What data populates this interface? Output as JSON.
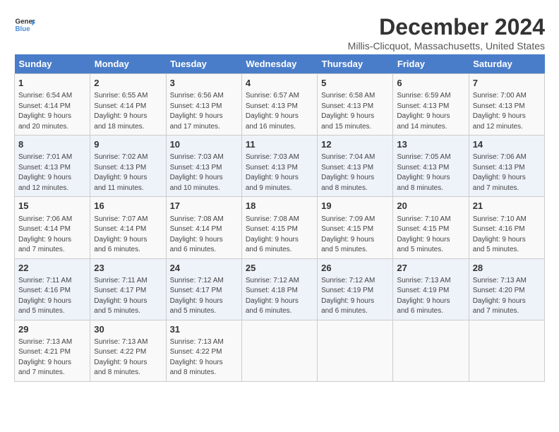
{
  "logo": {
    "general": "General",
    "blue": "Blue"
  },
  "title": "December 2024",
  "location": "Millis-Clicquot, Massachusetts, United States",
  "days_of_week": [
    "Sunday",
    "Monday",
    "Tuesday",
    "Wednesday",
    "Thursday",
    "Friday",
    "Saturday"
  ],
  "weeks": [
    [
      {
        "day": "1",
        "info": "Sunrise: 6:54 AM\nSunset: 4:14 PM\nDaylight: 9 hours\nand 20 minutes."
      },
      {
        "day": "2",
        "info": "Sunrise: 6:55 AM\nSunset: 4:14 PM\nDaylight: 9 hours\nand 18 minutes."
      },
      {
        "day": "3",
        "info": "Sunrise: 6:56 AM\nSunset: 4:13 PM\nDaylight: 9 hours\nand 17 minutes."
      },
      {
        "day": "4",
        "info": "Sunrise: 6:57 AM\nSunset: 4:13 PM\nDaylight: 9 hours\nand 16 minutes."
      },
      {
        "day": "5",
        "info": "Sunrise: 6:58 AM\nSunset: 4:13 PM\nDaylight: 9 hours\nand 15 minutes."
      },
      {
        "day": "6",
        "info": "Sunrise: 6:59 AM\nSunset: 4:13 PM\nDaylight: 9 hours\nand 14 minutes."
      },
      {
        "day": "7",
        "info": "Sunrise: 7:00 AM\nSunset: 4:13 PM\nDaylight: 9 hours\nand 12 minutes."
      }
    ],
    [
      {
        "day": "8",
        "info": "Sunrise: 7:01 AM\nSunset: 4:13 PM\nDaylight: 9 hours\nand 12 minutes."
      },
      {
        "day": "9",
        "info": "Sunrise: 7:02 AM\nSunset: 4:13 PM\nDaylight: 9 hours\nand 11 minutes."
      },
      {
        "day": "10",
        "info": "Sunrise: 7:03 AM\nSunset: 4:13 PM\nDaylight: 9 hours\nand 10 minutes."
      },
      {
        "day": "11",
        "info": "Sunrise: 7:03 AM\nSunset: 4:13 PM\nDaylight: 9 hours\nand 9 minutes."
      },
      {
        "day": "12",
        "info": "Sunrise: 7:04 AM\nSunset: 4:13 PM\nDaylight: 9 hours\nand 8 minutes."
      },
      {
        "day": "13",
        "info": "Sunrise: 7:05 AM\nSunset: 4:13 PM\nDaylight: 9 hours\nand 8 minutes."
      },
      {
        "day": "14",
        "info": "Sunrise: 7:06 AM\nSunset: 4:13 PM\nDaylight: 9 hours\nand 7 minutes."
      }
    ],
    [
      {
        "day": "15",
        "info": "Sunrise: 7:06 AM\nSunset: 4:14 PM\nDaylight: 9 hours\nand 7 minutes."
      },
      {
        "day": "16",
        "info": "Sunrise: 7:07 AM\nSunset: 4:14 PM\nDaylight: 9 hours\nand 6 minutes."
      },
      {
        "day": "17",
        "info": "Sunrise: 7:08 AM\nSunset: 4:14 PM\nDaylight: 9 hours\nand 6 minutes."
      },
      {
        "day": "18",
        "info": "Sunrise: 7:08 AM\nSunset: 4:15 PM\nDaylight: 9 hours\nand 6 minutes."
      },
      {
        "day": "19",
        "info": "Sunrise: 7:09 AM\nSunset: 4:15 PM\nDaylight: 9 hours\nand 5 minutes."
      },
      {
        "day": "20",
        "info": "Sunrise: 7:10 AM\nSunset: 4:15 PM\nDaylight: 9 hours\nand 5 minutes."
      },
      {
        "day": "21",
        "info": "Sunrise: 7:10 AM\nSunset: 4:16 PM\nDaylight: 9 hours\nand 5 minutes."
      }
    ],
    [
      {
        "day": "22",
        "info": "Sunrise: 7:11 AM\nSunset: 4:16 PM\nDaylight: 9 hours\nand 5 minutes."
      },
      {
        "day": "23",
        "info": "Sunrise: 7:11 AM\nSunset: 4:17 PM\nDaylight: 9 hours\nand 5 minutes."
      },
      {
        "day": "24",
        "info": "Sunrise: 7:12 AM\nSunset: 4:17 PM\nDaylight: 9 hours\nand 5 minutes."
      },
      {
        "day": "25",
        "info": "Sunrise: 7:12 AM\nSunset: 4:18 PM\nDaylight: 9 hours\nand 6 minutes."
      },
      {
        "day": "26",
        "info": "Sunrise: 7:12 AM\nSunset: 4:19 PM\nDaylight: 9 hours\nand 6 minutes."
      },
      {
        "day": "27",
        "info": "Sunrise: 7:13 AM\nSunset: 4:19 PM\nDaylight: 9 hours\nand 6 minutes."
      },
      {
        "day": "28",
        "info": "Sunrise: 7:13 AM\nSunset: 4:20 PM\nDaylight: 9 hours\nand 7 minutes."
      }
    ],
    [
      {
        "day": "29",
        "info": "Sunrise: 7:13 AM\nSunset: 4:21 PM\nDaylight: 9 hours\nand 7 minutes."
      },
      {
        "day": "30",
        "info": "Sunrise: 7:13 AM\nSunset: 4:22 PM\nDaylight: 9 hours\nand 8 minutes."
      },
      {
        "day": "31",
        "info": "Sunrise: 7:13 AM\nSunset: 4:22 PM\nDaylight: 9 hours\nand 8 minutes."
      },
      {
        "day": "",
        "info": ""
      },
      {
        "day": "",
        "info": ""
      },
      {
        "day": "",
        "info": ""
      },
      {
        "day": "",
        "info": ""
      }
    ]
  ]
}
